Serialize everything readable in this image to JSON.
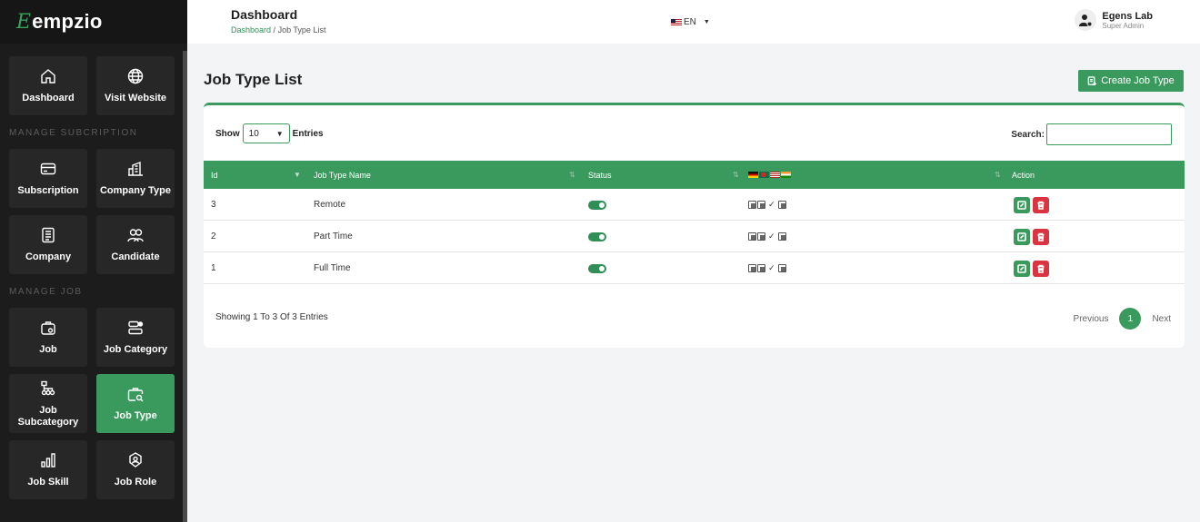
{
  "brand": {
    "logo_letter": "E",
    "logo_text": "empzio"
  },
  "sidebar": {
    "top_items": [
      {
        "label": "Dashboard",
        "icon": "home-icon"
      },
      {
        "label": "Visit Website",
        "icon": "globe-icon"
      }
    ],
    "section_subscription": "MANAGE SUBCRIPTION",
    "subscription_items": [
      {
        "label": "Subscription",
        "icon": "card-icon"
      },
      {
        "label": "Company Type",
        "icon": "building-icon"
      },
      {
        "label": "Company",
        "icon": "document-icon"
      },
      {
        "label": "Candidate",
        "icon": "users-icon"
      }
    ],
    "section_job": "MANAGE JOB",
    "job_items": [
      {
        "label": "Job",
        "icon": "briefcase-icon"
      },
      {
        "label": "Job Category",
        "icon": "category-icon"
      },
      {
        "label": "Job Subcategory",
        "icon": "hierarchy-icon"
      },
      {
        "label": "Job Type",
        "icon": "briefcase-search-icon",
        "active": true
      },
      {
        "label": "Job Skill",
        "icon": "bar-chart-icon"
      },
      {
        "label": "Job Role",
        "icon": "role-icon"
      }
    ]
  },
  "topbar": {
    "title": "Dashboard",
    "breadcrumb_home": "Dashboard",
    "breadcrumb_sep": "/",
    "breadcrumb_current": "Job Type List",
    "language": "EN",
    "user_name": "Egens Lab",
    "user_role": "Super Admin"
  },
  "page": {
    "title": "Job Type List",
    "create_label": "Create Job Type"
  },
  "table": {
    "show_label": "Show",
    "entries_label": "Entries",
    "page_size": "10",
    "search_label": "Search:",
    "columns": [
      "Id",
      "Job Type Name",
      "Status",
      "",
      "Action"
    ],
    "rows": [
      {
        "id": "3",
        "name": "Remote",
        "status": "active"
      },
      {
        "id": "2",
        "name": "Part Time",
        "status": "active"
      },
      {
        "id": "1",
        "name": "Full Time",
        "status": "active"
      }
    ],
    "translation_check": "✓",
    "showing_text": "Showing 1 To 3 Of 3 Entries",
    "prev_label": "Previous",
    "page_number": "1",
    "next_label": "Next"
  },
  "colors": {
    "accent": "#3a9a5e",
    "danger": "#d9343f",
    "sidebar": "#1c1c1c"
  }
}
